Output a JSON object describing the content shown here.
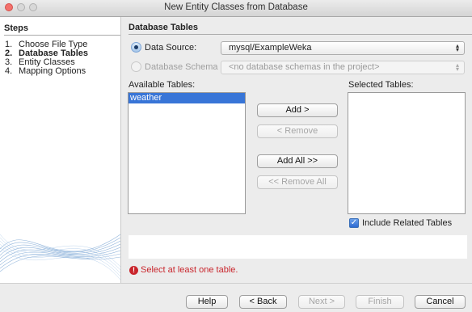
{
  "window": {
    "title": "New Entity Classes from Database"
  },
  "steps": {
    "title": "Steps",
    "items": [
      {
        "num": "1.",
        "label": "Choose File Type",
        "current": false
      },
      {
        "num": "2.",
        "label": "Database Tables",
        "current": true
      },
      {
        "num": "3.",
        "label": "Entity Classes",
        "current": false
      },
      {
        "num": "4.",
        "label": "Mapping Options",
        "current": false
      }
    ]
  },
  "panel": {
    "title": "Database Tables",
    "data_source": {
      "label": "Data Source:",
      "value": "mysql/ExampleWeka",
      "selected": true
    },
    "database_schema": {
      "label": "Database Schema",
      "value": "<no database schemas in the project>",
      "selected": false,
      "enabled": false
    },
    "available_tables": {
      "label": "Available Tables:",
      "items": [
        "weather"
      ],
      "selected_index": 0
    },
    "selected_tables": {
      "label": "Selected Tables:",
      "items": []
    },
    "buttons": {
      "add": "Add >",
      "remove": "< Remove",
      "add_all": "Add All >>",
      "remove_all": "<< Remove All"
    },
    "include_related": {
      "label": "Include Related Tables",
      "checked": true
    },
    "error_message": "Select at least one table."
  },
  "footer": {
    "help": "Help",
    "back": "< Back",
    "next": "Next >",
    "finish": "Finish",
    "cancel": "Cancel"
  },
  "colors": {
    "selection": "#3875d7",
    "error": "#c9252c"
  }
}
